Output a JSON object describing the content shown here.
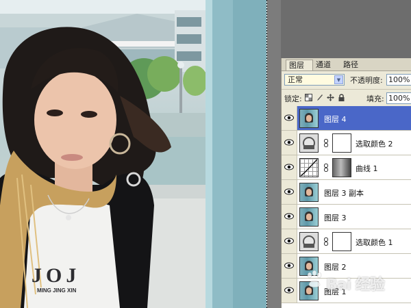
{
  "colors": {
    "panel_bg": "#ece9d8",
    "selected_row": "#4a67c8",
    "canvas_gray": "#6d6d6d"
  },
  "panel": {
    "tabs": [
      {
        "label": "图层",
        "active": true
      },
      {
        "label": "通道",
        "active": false
      },
      {
        "label": "路径",
        "active": false
      }
    ],
    "blend_mode": "正常",
    "opacity_label": "不透明度:",
    "opacity_value": "100%",
    "lock_label": "锁定:",
    "fill_label": "填充:",
    "fill_value": "100%",
    "lock_icons": [
      "lock-transparency-icon",
      "lock-paint-icon",
      "lock-move-icon",
      "lock-all-icon"
    ]
  },
  "layers": [
    {
      "name": "图层 4",
      "thumb": "photo",
      "mask": false,
      "selected": true,
      "visible": true
    },
    {
      "name": "选取颜色 2",
      "thumb": "adjustment",
      "mask": "white",
      "selected": false,
      "visible": true
    },
    {
      "name": "曲线 1",
      "thumb": "curves",
      "mask": "dark",
      "selected": false,
      "visible": true
    },
    {
      "name": "图层 3 副本",
      "thumb": "photo",
      "mask": false,
      "selected": false,
      "visible": true
    },
    {
      "name": "图层 3",
      "thumb": "photo",
      "mask": false,
      "selected": false,
      "visible": true
    },
    {
      "name": "选取颜色 1",
      "thumb": "adjustment",
      "mask": "white",
      "selected": false,
      "visible": true
    },
    {
      "name": "图层 2",
      "thumb": "photo",
      "mask": false,
      "selected": false,
      "visible": true
    },
    {
      "name": "图层 1",
      "thumb": "photo",
      "mask": false,
      "selected": false,
      "visible": true
    }
  ],
  "watermark": {
    "text": "Bai 经验",
    "logo": "baidu-paw-logo"
  },
  "photo": {
    "shirt_text": "JOJ",
    "shirt_small_text": "MING JING XIN"
  }
}
